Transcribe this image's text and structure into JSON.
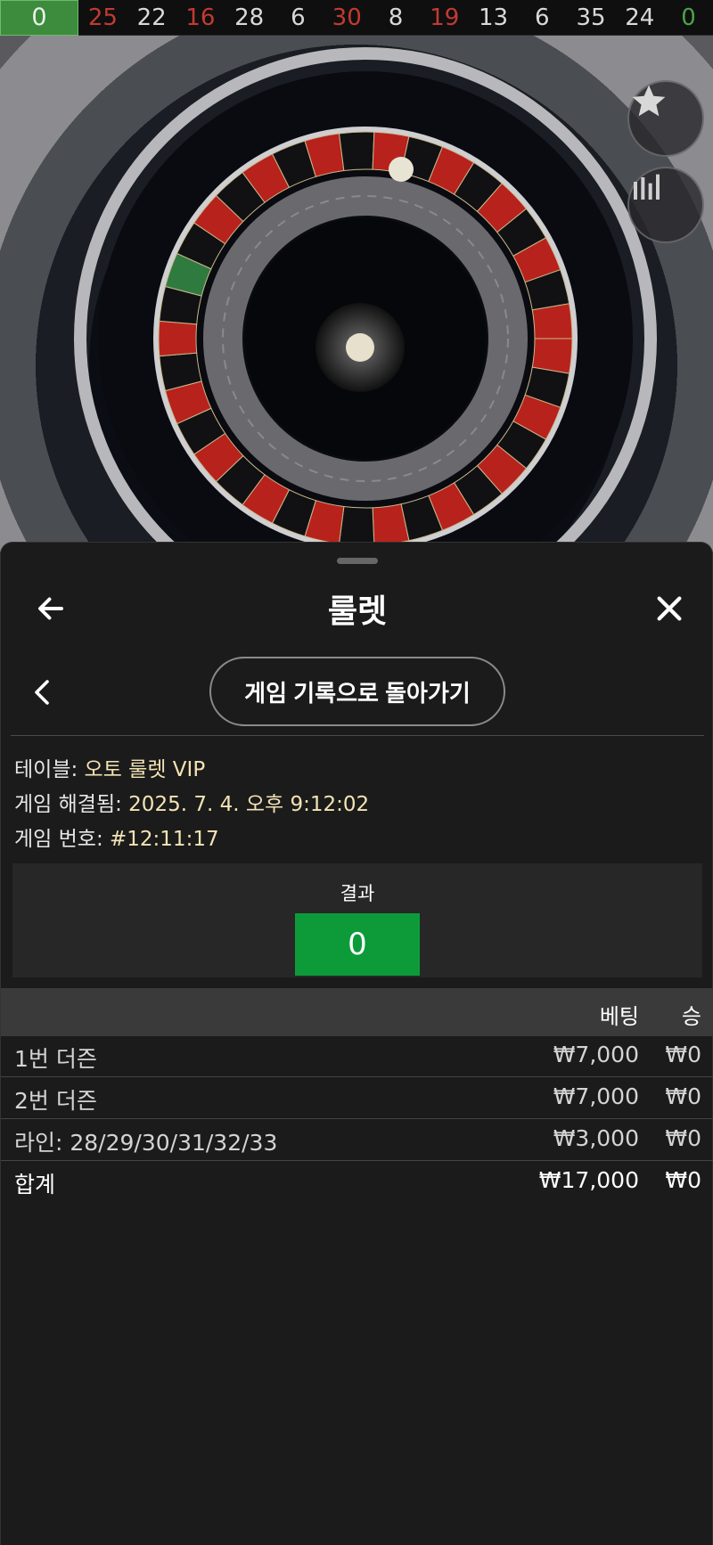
{
  "history": [
    {
      "n": "0",
      "color": "green"
    },
    {
      "n": "25",
      "color": "red"
    },
    {
      "n": "22",
      "color": "black"
    },
    {
      "n": "16",
      "color": "red"
    },
    {
      "n": "28",
      "color": "black"
    },
    {
      "n": "6",
      "color": "black"
    },
    {
      "n": "30",
      "color": "red"
    },
    {
      "n": "8",
      "color": "black"
    },
    {
      "n": "19",
      "color": "red"
    },
    {
      "n": "13",
      "color": "black"
    },
    {
      "n": "6",
      "color": "black"
    },
    {
      "n": "35",
      "color": "black"
    },
    {
      "n": "24",
      "color": "black"
    },
    {
      "n": "0",
      "color": "green"
    }
  ],
  "colors": {
    "green_result": "#0d9b3a",
    "red": "#c23a32",
    "gold_text": "#f3e4b4"
  },
  "icons": {
    "favorite": "star-icon",
    "stats": "bar-chart-icon",
    "back": "arrow-left-icon",
    "close": "close-icon",
    "chevron": "chevron-left-icon"
  },
  "sheet": {
    "title": "룰렛",
    "return_label": "게임 기록으로 돌아가기",
    "info": {
      "table_label": "테이블: ",
      "table_value": "오토 룰렛 VIP",
      "resolved_label": "게임 해결됨: ",
      "resolved_value": "2025. 7. 4. 오후 9:12:02",
      "round_label": "게임 번호: ",
      "round_value": "#12:11:17"
    },
    "result": {
      "label": "결과",
      "value": "0"
    },
    "bets": {
      "header_bet": "베팅",
      "header_win": "승",
      "rows": [
        {
          "label": "1번 더즌",
          "bet": "₩7,000",
          "win": "₩0"
        },
        {
          "label": "2번 더즌",
          "bet": "₩7,000",
          "win": "₩0"
        },
        {
          "label": "라인: 28/29/30/31/32/33",
          "bet": "₩3,000",
          "win": "₩0"
        }
      ],
      "total": {
        "label": "합계",
        "bet": "₩17,000",
        "win": "₩0"
      }
    }
  }
}
